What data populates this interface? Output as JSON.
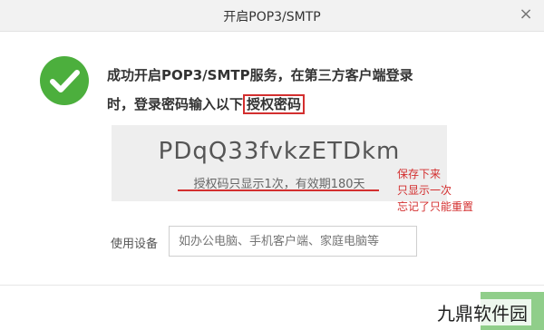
{
  "window": {
    "title": "开启POP3/SMTP",
    "close_glyph": "×"
  },
  "success": {
    "icon": "checkmark-icon",
    "color": "#4caf3d",
    "message_prefix": "成功开启POP3/SMTP服务，在第三方客户端登录时，登录密码输入以下",
    "message_highlight": "授权密码"
  },
  "auth_code": {
    "code": "PDqQ33fvkzETDkm",
    "note": "授权码只显示1次，有效期180天"
  },
  "annotation": {
    "lines": [
      "保存下来",
      "只显示一次",
      "忘记了只能重置"
    ],
    "color": "#d32f2f"
  },
  "device": {
    "label": "使用设备",
    "placeholder": "如办公电脑、手机客户端、家庭电脑等"
  },
  "watermark": "九鼎软件园"
}
